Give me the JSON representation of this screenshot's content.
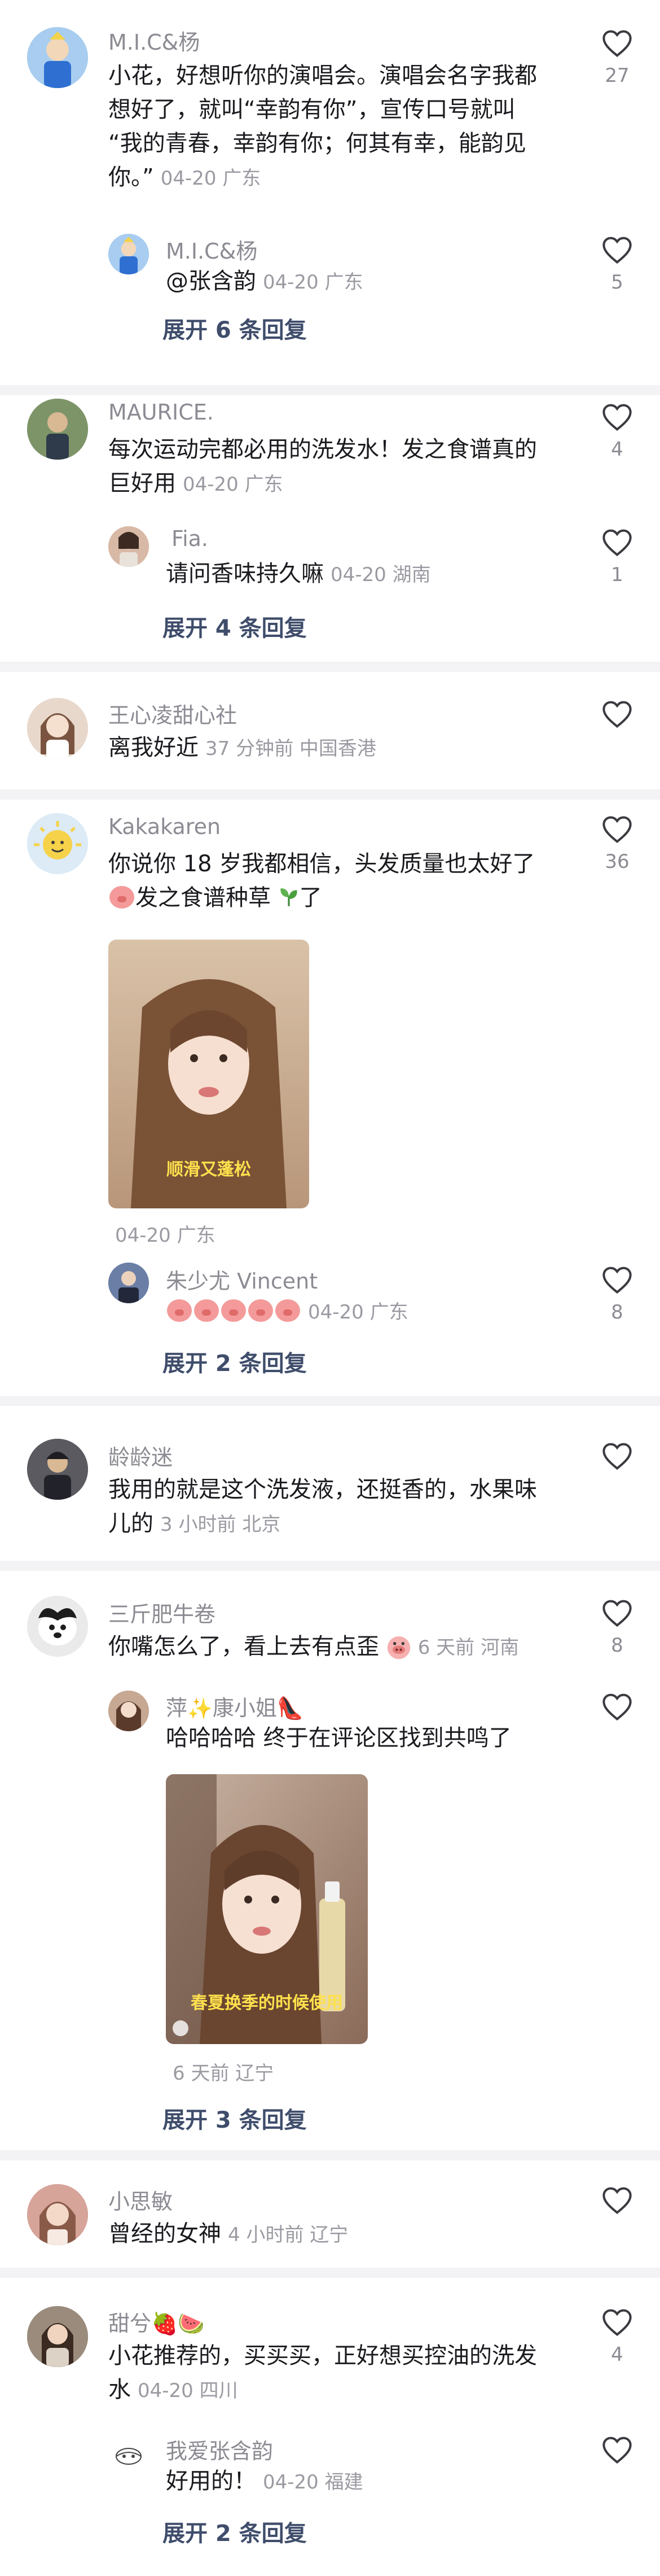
{
  "threads": [
    {
      "comment": {
        "user": "M.I.C&杨",
        "lines": [
          "小花，好想听你的演唱会。演唱会名字我都",
          "想好了，就叫“幸韵有你”，宣传口号就叫",
          "“我的青春，幸韵有你；何其有幸，能韵见",
          "你。”"
        ],
        "meta": "04-20 广东",
        "likes": "27"
      },
      "reply": {
        "user": "M.I.C&杨",
        "mention": "@张含韵",
        "meta": "04-20 广东",
        "likes": "5"
      },
      "expand": "展开 6 条回复"
    },
    {
      "comment": {
        "user": "MAURICE.",
        "lines": [
          "每次运动完都必用的洗发水！发之食谱真的",
          "巨好用"
        ],
        "meta": "04-20 广东",
        "likes": "4"
      },
      "reply": {
        "user": "Fia.",
        "text": "请问香味持久嘛",
        "meta": "04-20 湖南",
        "likes": "1"
      },
      "expand": "展开 4 条回复"
    },
    {
      "comment": {
        "user": "王心凌甜心社",
        "text": "离我好近",
        "meta": "37 分钟前 中国香港"
      }
    },
    {
      "comment": {
        "user": "Kakakaren",
        "lines": [
          "你说你 18 岁我都相信，头发质量也太好了",
          "发之食谱种草",
          "了"
        ],
        "image_caption": "顺滑又蓬松",
        "meta": "04-20 广东",
        "likes": "36"
      },
      "reply": {
        "user": "朱少尤 Vincent",
        "meta": "04-20 广东",
        "likes": "8"
      },
      "expand": "展开 2 条回复"
    },
    {
      "comment": {
        "user": "龄龄迷",
        "lines": [
          "我用的就是这个洗发液，还挺香的，水果味",
          "儿的"
        ],
        "meta": "3 小时前 北京"
      }
    },
    {
      "comment": {
        "user": "三斤肥牛卷",
        "text": "你嘴怎么了，看上去有点歪",
        "meta": "6 天前 河南",
        "likes": "8"
      },
      "reply": {
        "user": "萍",
        "user2": "康小姐",
        "text": "哈哈哈哈 终于在评论区找到共鸣了",
        "image_caption": "春夏换季的时候使用",
        "meta": "6 天前 辽宁"
      },
      "expand": "展开 3 条回复"
    },
    {
      "comment": {
        "user": "小思敏",
        "text": "曾经的女神",
        "meta": "4 小时前 辽宁"
      }
    },
    {
      "comment": {
        "user": "甜兮",
        "lines": [
          "小花推荐的，买买买，正好想买控油的洗发",
          "水"
        ],
        "meta": "04-20 四川",
        "likes": "4"
      },
      "reply": {
        "user": "我爱张含韵",
        "text": "好用的！",
        "meta": "04-20 福建"
      },
      "expand": "展开 2 条回复"
    }
  ],
  "colors": {
    "username": "#8b8b93",
    "body": "#1a1a1f",
    "meta": "#9a9aa2",
    "expand": "#3f4d6b",
    "divider": "#f3f3f5"
  },
  "icons": {
    "like": "heart-outline-icon"
  }
}
